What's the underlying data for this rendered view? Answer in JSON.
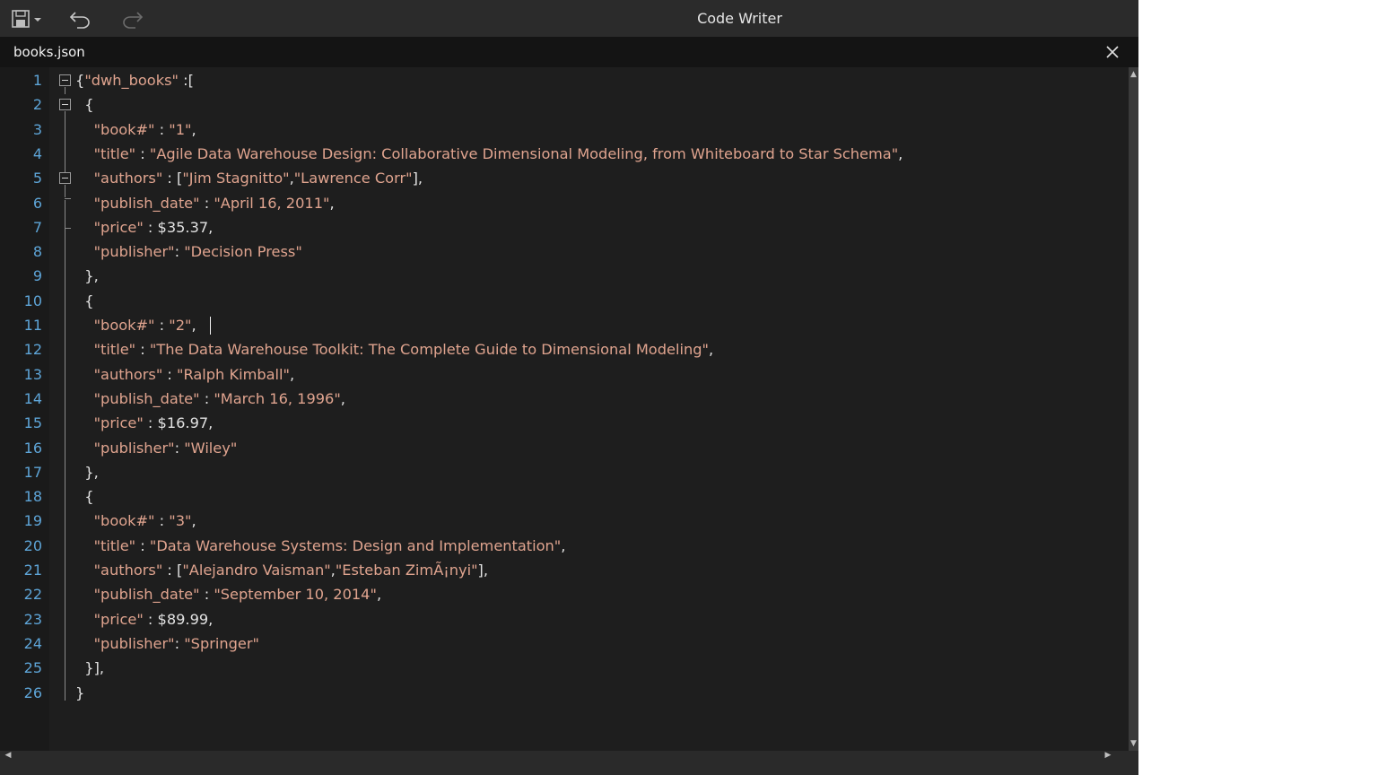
{
  "window": {
    "title": "Code Writer"
  },
  "toolbar": {
    "save_icon": "save-icon",
    "undo_icon": "undo-icon",
    "redo_icon": "redo-icon"
  },
  "tab": {
    "label": "books.json",
    "close_icon": "close-icon"
  },
  "editor": {
    "line_numbers": [
      "1",
      "2",
      "3",
      "4",
      "5",
      "6",
      "7",
      "8",
      "9",
      "10",
      "11",
      "12",
      "13",
      "14",
      "15",
      "16",
      "17",
      "18",
      "19",
      "20",
      "21",
      "22",
      "23",
      "24",
      "25",
      "26"
    ],
    "lines": [
      "{\"dwh_books\" :[",
      "  {",
      "    \"book#\" : \"1\",",
      "    \"title\" : \"Agile Data Warehouse Design: Collaborative Dimensional Modeling, from Whiteboard to Star Schema\",",
      "    \"authors\" : [\"Jim Stagnitto\",\"Lawrence Corr\"],",
      "    \"publish_date\" : \"April 16, 2011\",",
      "    \"price\" : $35.37,",
      "    \"publisher\": \"Decision Press\"",
      "  },",
      "  {",
      "    \"book#\" : \"2\",",
      "    \"title\" : \"The Data Warehouse Toolkit: The Complete Guide to Dimensional Modeling\",",
      "    \"authors\" : \"Ralph Kimball\",",
      "    \"publish_date\" : \"March 16, 1996\",",
      "    \"price\" : $16.97,",
      "    \"publisher\": \"Wiley\"",
      "  },",
      "  {",
      "    \"book#\" : \"3\",",
      "    \"title\" : \"Data Warehouse Systems: Design and Implementation\",",
      "    \"authors\" : [\"Alejandro Vaisman\",\"Esteban ZimÃ¡nyi\"],",
      "    \"publish_date\" : \"September 10, 2014\",",
      "    \"price\" : $89.99,",
      "    \"publisher\": \"Springer\"",
      "  }],",
      "}"
    ]
  },
  "colors": {
    "background": "#1e1e1e",
    "line_number": "#5ea5d8",
    "string": "#e0a48f",
    "punctuation": "#e2e2e2"
  }
}
